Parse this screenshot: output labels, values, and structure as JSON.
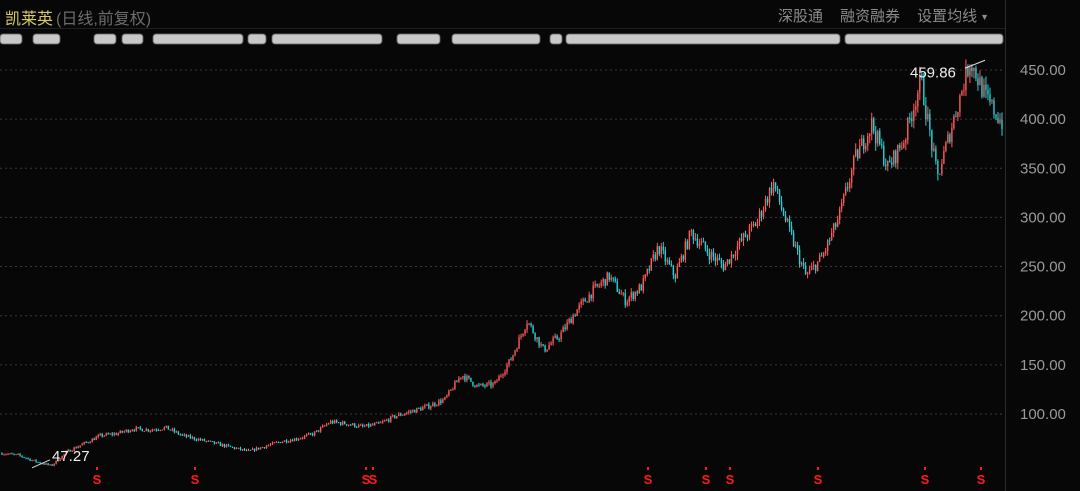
{
  "header": {
    "stock_name": "凯莱英",
    "mode": "(日线,前复权)",
    "tools": [
      "深股通",
      "融资融券",
      "设置均线"
    ]
  },
  "colors": {
    "up": "#ff5a5a",
    "down": "#22d3d8",
    "marker": "#ff1a1a",
    "grid": "#3a3a3a",
    "axis_text": "#9a9a9a"
  },
  "chart_data": {
    "type": "candlestick",
    "ylim": [
      40,
      475
    ],
    "yticks": [
      "450.00",
      "400.00",
      "350.00",
      "300.00",
      "250.00",
      "200.00",
      "150.00",
      "100.00"
    ],
    "ytick_values": [
      450,
      400,
      350,
      300,
      250,
      200,
      150,
      100
    ],
    "grid": true,
    "annotations": [
      {
        "label": "459.86",
        "value": 459.86,
        "kind": "high"
      },
      {
        "label": "47.27",
        "value": 47.27,
        "kind": "low"
      }
    ],
    "trend_closes": [
      60,
      58,
      52,
      47.27,
      62,
      70,
      78,
      80,
      85,
      84,
      86,
      78,
      74,
      70,
      66,
      62,
      67,
      72,
      75,
      80,
      92,
      90,
      87,
      90,
      98,
      103,
      108,
      115,
      140,
      128,
      130,
      155,
      195,
      165,
      180,
      205,
      225,
      240,
      215,
      230,
      270,
      240,
      285,
      265,
      250,
      275,
      295,
      335,
      285,
      240,
      260,
      300,
      360,
      395,
      350,
      380,
      440,
      340,
      400,
      459.86,
      420,
      395
    ],
    "dividend_markers": [
      "S",
      "S",
      "S",
      "S",
      "S",
      "S",
      "S",
      "S",
      "S",
      "S"
    ]
  }
}
